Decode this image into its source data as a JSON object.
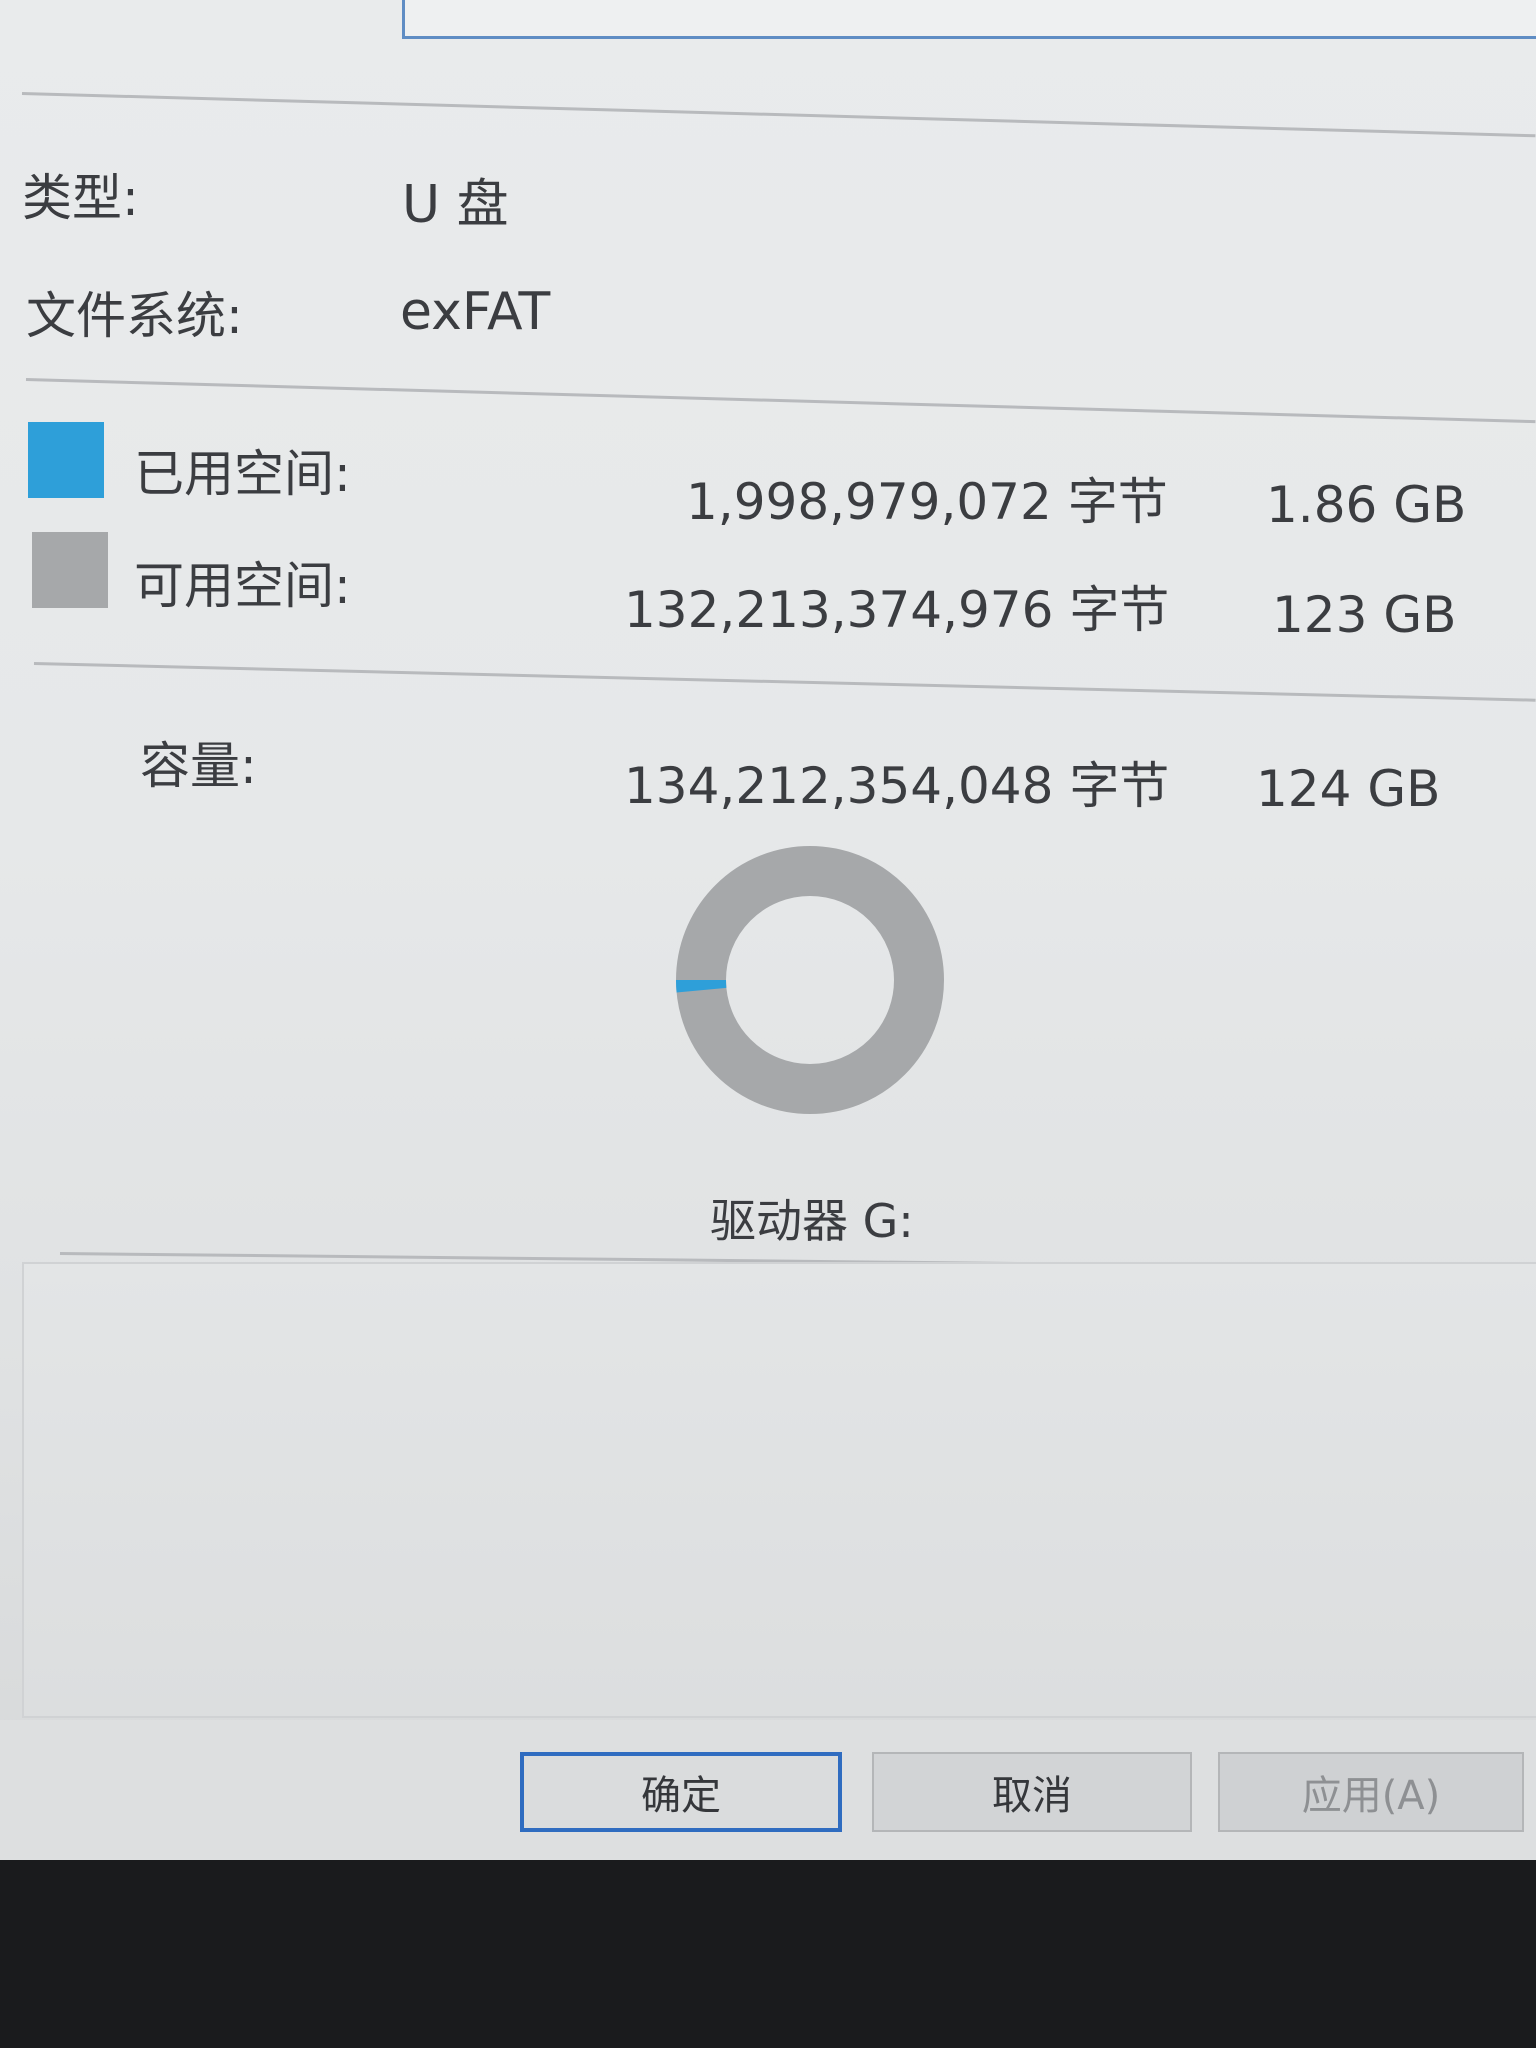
{
  "properties": {
    "type_label": "类型:",
    "type_value": "U 盘",
    "fs_label": "文件系统:",
    "fs_value": "exFAT"
  },
  "usage": {
    "used_label": "已用空间:",
    "used_bytes": "1,998,979,072 字节",
    "used_size": "1.86 GB",
    "free_label": "可用空间:",
    "free_bytes": "132,213,374,976 字节",
    "free_size": "123 GB",
    "capacity_label": "容量:",
    "capacity_bytes": "134,212,354,048 字节",
    "capacity_size": "124 GB",
    "used_fraction": 0.0149,
    "colors": {
      "used": "#2e9fd9",
      "free": "#a6a8aa"
    }
  },
  "drive_label": "驱动器 G:",
  "buttons": {
    "ok": "确定",
    "cancel": "取消",
    "apply": "应用(A)"
  }
}
